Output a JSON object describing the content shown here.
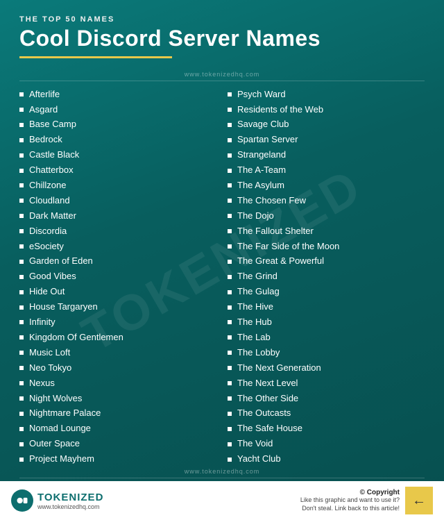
{
  "header": {
    "subtitle": "THE TOP 50 NAMES",
    "main_title": "Cool Discord Server Names",
    "website": "www.tokenizedhq.com"
  },
  "watermark": "TOKENIZED",
  "left_column": [
    "Afterlife",
    "Asgard",
    "Base Camp",
    "Bedrock",
    "Castle Black",
    "Chatterbox",
    "Chillzone",
    "Cloudland",
    "Dark Matter",
    "Discordia",
    "eSociety",
    "Garden of Eden",
    "Good Vibes",
    "Hide Out",
    "House Targaryen",
    "Infinity",
    "Kingdom Of Gentlemen",
    "Music Loft",
    "Neo Tokyo",
    "Nexus",
    "Night Wolves",
    "Nightmare Palace",
    "Nomad Lounge",
    "Outer Space",
    "Project Mayhem"
  ],
  "right_column": [
    "Psych Ward",
    "Residents of the Web",
    "Savage Club",
    "Spartan Server",
    "Strangeland",
    "The A-Team",
    "The Asylum",
    "The Chosen Few",
    "The Dojo",
    "The Fallout Shelter",
    "The Far Side of the Moon",
    "The Great & Powerful",
    "The Grind",
    "The Gulag",
    "The Hive",
    "The Hub",
    "The Lab",
    "The Lobby",
    "The Next Generation",
    "The Next Level",
    "The Other Side",
    "The Outcasts",
    "The Safe House",
    "The Void",
    "Yacht Club"
  ],
  "footer": {
    "logo_brand": "TOKENIZED",
    "logo_url": "www.tokenizedhq.com",
    "copyright": "© Copyright",
    "note_line1": "Like this graphic and want to use it?",
    "note_line2": "Don't steal. Link back to this article!"
  }
}
